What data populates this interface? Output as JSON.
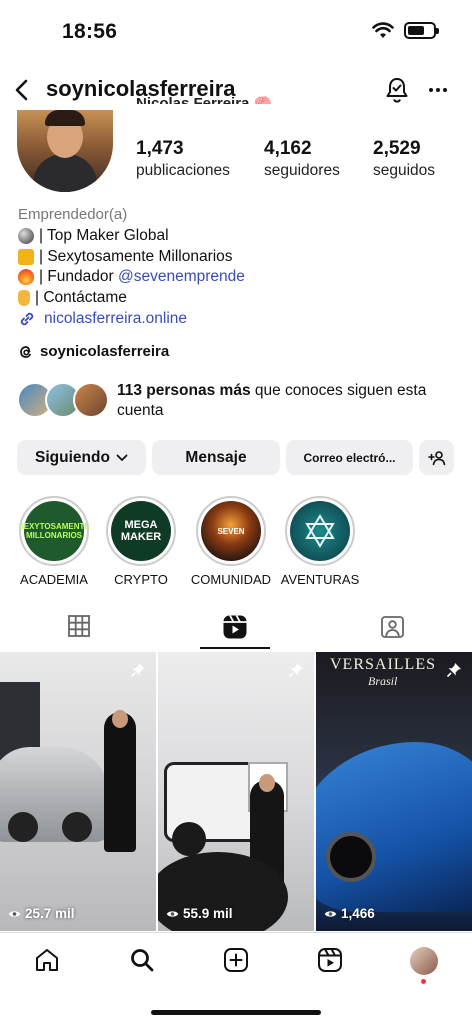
{
  "status_bar": {
    "time": "18:56"
  },
  "header": {
    "username": "soynicolasferreira"
  },
  "profile": {
    "full_name": "Nicolas Ferreira 🧠",
    "stats": [
      {
        "value": "1,473",
        "label": "publicaciones"
      },
      {
        "value": "4,162",
        "label": "seguidores"
      },
      {
        "value": "2,529",
        "label": "seguidos"
      }
    ],
    "category": "Emprendedor(a)",
    "bio": [
      {
        "prefix": "| Top Maker Global",
        "mention": ""
      },
      {
        "prefix": "| Sexytosamente Millonarios",
        "mention": ""
      },
      {
        "prefix": "| Fundador ",
        "mention": "@sevenemprende"
      },
      {
        "prefix": "| Contáctame",
        "mention": ""
      }
    ],
    "link": "nicolasferreira.online",
    "threads_handle": "soynicolasferreira",
    "mutual": {
      "bold": "113 personas más",
      "rest": " que conoces siguen esta cuenta"
    }
  },
  "buttons": {
    "following": "Siguiendo",
    "message": "Mensaje",
    "email": "Correo electró..."
  },
  "highlights": [
    {
      "label": "ACADEMIA",
      "inner": "SEXYTOSAMENTE MILLONARIOS"
    },
    {
      "label": "CRYPTO",
      "inner": "MEGA MAKER"
    },
    {
      "label": "COMUNIDAD",
      "inner": "SEVEN"
    },
    {
      "label": "AVENTURAS",
      "inner": ""
    }
  ],
  "posts": [
    {
      "views": "25.7 mil"
    },
    {
      "views": "55.9 mil"
    },
    {
      "views": "1,466",
      "sign": "VERSAILLES",
      "sign_sub": "Brasil"
    }
  ],
  "icons": {
    "back": "chevron-left-icon",
    "bell": "bell-icon",
    "more": "more-icon",
    "link": "link-icon",
    "threads": "threads-icon",
    "grid": "grid-icon",
    "reels": "reels-icon",
    "tagged": "tagged-icon",
    "home": "home-icon",
    "search": "search-icon",
    "create": "create-icon",
    "profile": "avatar"
  },
  "colors": {
    "accent_link": "#3b4bb8",
    "button_bg": "#efeff2",
    "notification_dot": "#ff3040"
  }
}
